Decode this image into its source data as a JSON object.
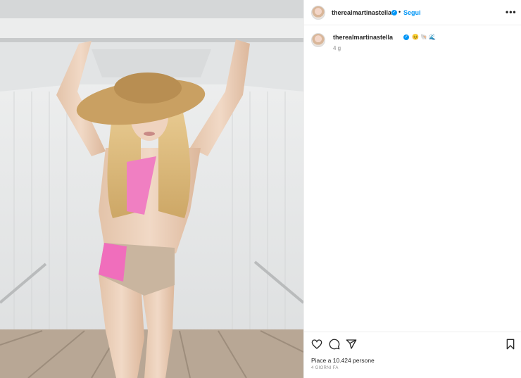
{
  "post": {
    "username": "therealmartinastella",
    "separator": "•",
    "follow_label": "Segui",
    "more_label": "•••",
    "caption_username": "therealmartinastella",
    "caption_emojis": [
      "😊",
      "🐚",
      "🌊"
    ],
    "time_ago": "4 g",
    "likes_text": "Piace a 10.424 persone",
    "date_text": "4 GIORNI FA"
  },
  "icons": {
    "verified": "verified-badge-icon",
    "like": "heart-icon",
    "comment": "comment-icon",
    "share": "paper-plane-icon",
    "save": "bookmark-icon",
    "more": "more-options-icon"
  },
  "colors": {
    "link_blue": "#0095f6",
    "text": "#262626",
    "muted": "#8e8e8e",
    "border": "#efefef"
  }
}
